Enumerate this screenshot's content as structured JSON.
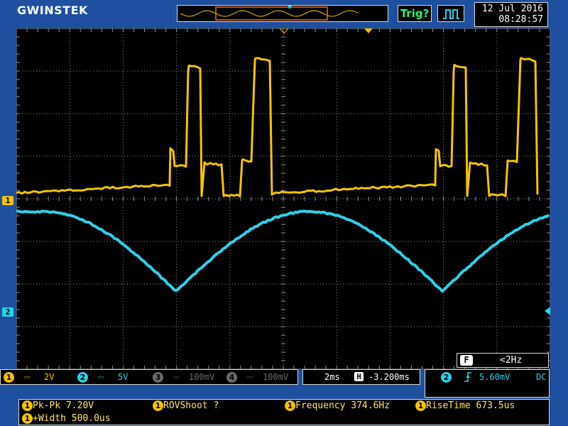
{
  "brand": "GWINSTEK",
  "top": {
    "trigger_status": "Trig?",
    "date": "12 Jul 2016",
    "time": "08:28:57"
  },
  "colors": {
    "ch1": "#f2c400",
    "ch2": "#2ed0e8",
    "grid": "#8f8f8f",
    "off": "#6b6b6b"
  },
  "markers": {
    "ch1": "1",
    "ch2": "2",
    "trigger_icon": "trigger-position-marker"
  },
  "channels": [
    {
      "num": "1",
      "coupling": "DC",
      "scale": "2V",
      "enabled": true
    },
    {
      "num": "2",
      "coupling": "DC",
      "scale": "5V",
      "enabled": true
    },
    {
      "num": "3",
      "coupling": "DC",
      "scale": "100mV",
      "enabled": false
    },
    {
      "num": "4",
      "coupling": "DC",
      "scale": "100mV",
      "enabled": false
    }
  ],
  "timebase": {
    "scale": "2ms",
    "position_icon": "H",
    "position": "-3.200ms"
  },
  "trigger": {
    "source": "2",
    "slope_icon": "rising-edge",
    "level": "5.60mV",
    "coupling": "DC"
  },
  "freq_counter": {
    "icon": "F",
    "value": "<2Hz"
  },
  "measurements": {
    "pkpk": "Pk-Pk 7.20V",
    "rovshoot": "ROVShoot ?",
    "frequency": "Frequency 374.6Hz",
    "risetime": "RiseTime 673.5us",
    "pwidth": "+Width 500.0us",
    "source": "1"
  }
}
